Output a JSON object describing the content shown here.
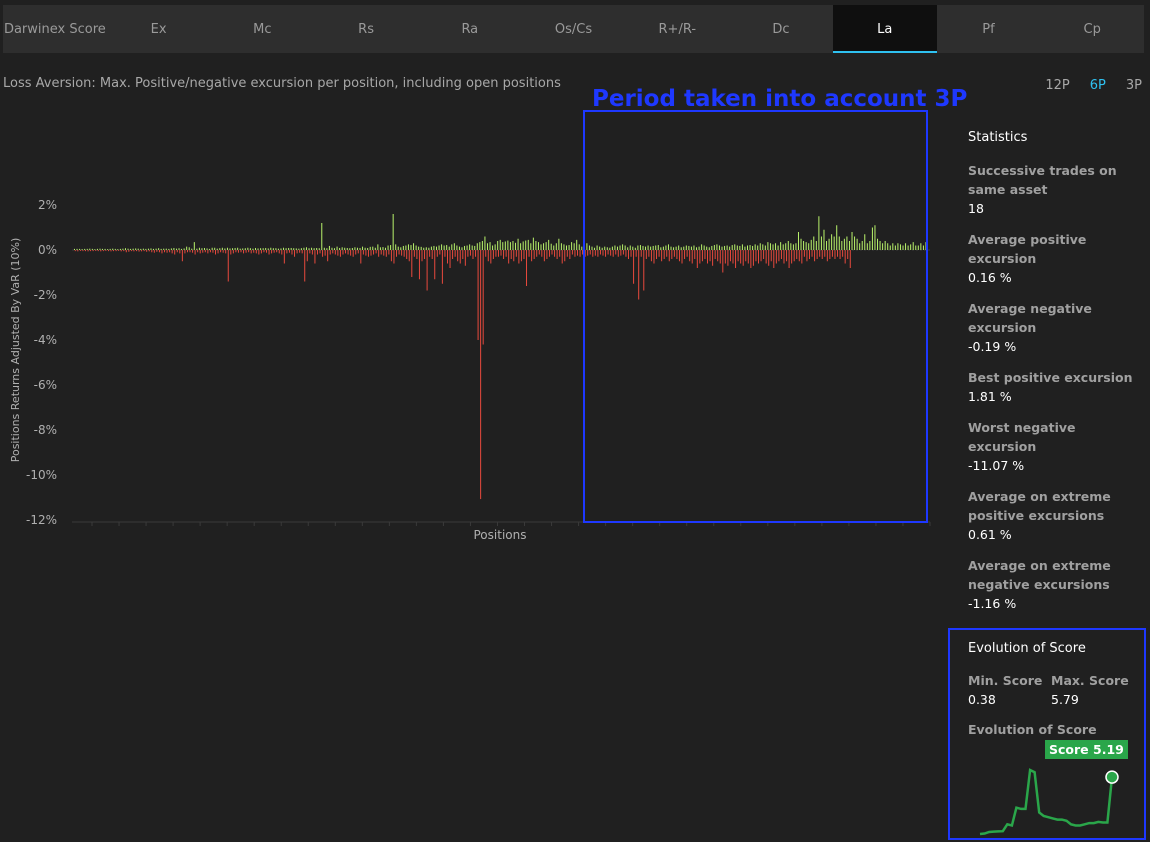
{
  "tabs": [
    {
      "label": "Darwinex Score"
    },
    {
      "label": "Ex"
    },
    {
      "label": "Mc"
    },
    {
      "label": "Rs"
    },
    {
      "label": "Ra"
    },
    {
      "label": "Os/Cs"
    },
    {
      "label": "R+/R-"
    },
    {
      "label": "Dc"
    },
    {
      "label": "La",
      "active": true
    },
    {
      "label": "Pf"
    },
    {
      "label": "Cp"
    }
  ],
  "subtitle": "Loss Aversion: Max. Positive/negative excursion per position, including open positions",
  "periods": [
    "12P",
    "6P",
    "3P"
  ],
  "active_period": "6P",
  "annotation": {
    "label": "Period taken into account 3P"
  },
  "statistics": {
    "title": "Statistics",
    "items": [
      {
        "label": "Successive trades on same asset",
        "value": "18"
      },
      {
        "label": "Average positive excursion",
        "value": "0.16 %"
      },
      {
        "label": "Average negative excursion",
        "value": "-0.19 %"
      },
      {
        "label": "Best positive excursion",
        "value": "1.81 %"
      },
      {
        "label": "Worst negative excursion",
        "value": "-11.07 %"
      },
      {
        "label": "Average on extreme positive excursions",
        "value": "0.61 %"
      },
      {
        "label": "Average on extreme negative excursions",
        "value": "-1.16 %"
      }
    ]
  },
  "evolution": {
    "title": "Evolution of Score",
    "min_label": "Min. Score",
    "min_value": "0.38",
    "max_label": "Max. Score",
    "max_value": "5.79",
    "subtitle": "Evolution of Score",
    "badge": "Score 5.19",
    "series": [
      0.38,
      0.42,
      0.55,
      0.58,
      0.6,
      0.62,
      1.2,
      1.1,
      2.6,
      2.5,
      2.5,
      5.79,
      5.6,
      2.2,
      1.9,
      1.8,
      1.7,
      1.6,
      1.6,
      1.5,
      1.2,
      1.1,
      1.1,
      1.2,
      1.3,
      1.3,
      1.4,
      1.35,
      1.35,
      5.19
    ],
    "line_color": "#2aa64a"
  },
  "colors": {
    "positive": "#b9f36b",
    "negative": "#e8493d",
    "accent": "#2fc1f0",
    "annotation": "#1e38ff"
  },
  "chart_data": {
    "type": "bar",
    "title": "",
    "xlabel": "Positions",
    "ylabel": "Positions Returns Adjusted By VaR (10%)",
    "yticks": [
      "2%",
      "0%",
      "-2%",
      "-4%",
      "-6%",
      "-8%",
      "-10%",
      "-12%"
    ],
    "ylim": [
      -12,
      2.5
    ],
    "positive_excursions": [
      0.05,
      0.05,
      0.05,
      0.04,
      0.05,
      0.05,
      0.06,
      0.05,
      0.04,
      0.05,
      0.06,
      0.05,
      0.05,
      0.04,
      0.05,
      0.06,
      0.05,
      0.04,
      0.05,
      0.06,
      0.08,
      0.06,
      0.05,
      0.06,
      0.07,
      0.06,
      0.05,
      0.06,
      0.05,
      0.06,
      0.07,
      0.05,
      0.06,
      0.08,
      0.05,
      0.06,
      0.06,
      0.05,
      0.07,
      0.09,
      0.06,
      0.08,
      0.05,
      0.07,
      0.15,
      0.12,
      0.06,
      0.35,
      0.06,
      0.1,
      0.08,
      0.09,
      0.07,
      0.05,
      0.1,
      0.1,
      0.06,
      0.08,
      0.1,
      0.07,
      0.1,
      0.07,
      0.08,
      0.09,
      0.1,
      0.06,
      0.07,
      0.08,
      0.1,
      0.08,
      0.06,
      0.09,
      0.07,
      0.08,
      0.08,
      0.09,
      0.07,
      0.1,
      0.08,
      0.08,
      0.06,
      0.07,
      0.1,
      0.08,
      0.09,
      0.09,
      0.08,
      0.07,
      0.06,
      0.08,
      0.1,
      0.12,
      0.08,
      0.1,
      0.08,
      0.09,
      0.08,
      1.2,
      0.1,
      0.08,
      0.18,
      0.1,
      0.08,
      0.15,
      0.09,
      0.12,
      0.1,
      0.09,
      0.08,
      0.09,
      0.12,
      0.1,
      0.09,
      0.15,
      0.1,
      0.09,
      0.14,
      0.15,
      0.1,
      0.25,
      0.12,
      0.13,
      0.1,
      0.2,
      0.22,
      1.6,
      0.25,
      0.15,
      0.12,
      0.18,
      0.2,
      0.25,
      0.22,
      0.3,
      0.2,
      0.15,
      0.14,
      0.1,
      0.12,
      0.1,
      0.15,
      0.18,
      0.15,
      0.2,
      0.25,
      0.2,
      0.22,
      0.15,
      0.25,
      0.3,
      0.2,
      0.15,
      0.12,
      0.18,
      0.2,
      0.25,
      0.2,
      0.18,
      0.3,
      0.35,
      0.4,
      0.6,
      0.3,
      0.35,
      0.2,
      0.25,
      0.4,
      0.45,
      0.35,
      0.38,
      0.42,
      0.35,
      0.4,
      0.32,
      0.5,
      0.3,
      0.38,
      0.42,
      0.45,
      0.3,
      0.55,
      0.4,
      0.35,
      0.25,
      0.3,
      0.35,
      0.45,
      0.28,
      0.2,
      0.3,
      0.5,
      0.3,
      0.25,
      0.2,
      0.22,
      0.35,
      0.3,
      0.45,
      0.25,
      0.15,
      0.5,
      0.3,
      0.2,
      0.15,
      0.1,
      0.2,
      0.15,
      0.1,
      0.15,
      0.12,
      0.1,
      0.15,
      0.2,
      0.15,
      0.2,
      0.25,
      0.2,
      0.12,
      0.2,
      0.15,
      0.1,
      0.2,
      0.22,
      0.18,
      0.15,
      0.2,
      0.15,
      0.18,
      0.2,
      0.22,
      0.12,
      0.15,
      0.2,
      0.25,
      0.15,
      0.12,
      0.15,
      0.2,
      0.12,
      0.15,
      0.2,
      0.18,
      0.15,
      0.2,
      0.12,
      0.15,
      0.25,
      0.2,
      0.15,
      0.12,
      0.18,
      0.22,
      0.25,
      0.2,
      0.15,
      0.18,
      0.2,
      0.15,
      0.22,
      0.25,
      0.2,
      0.18,
      0.25,
      0.15,
      0.2,
      0.22,
      0.18,
      0.25,
      0.2,
      0.3,
      0.25,
      0.2,
      0.35,
      0.3,
      0.25,
      0.3,
      0.2,
      0.35,
      0.25,
      0.3,
      0.4,
      0.3,
      0.25,
      0.3,
      0.8,
      0.5,
      0.4,
      0.35,
      0.3,
      0.45,
      0.6,
      0.4,
      1.5,
      0.6,
      0.9,
      0.4,
      0.5,
      0.7,
      0.6,
      1.1,
      0.6,
      0.4,
      0.5,
      0.6,
      0.4,
      0.8,
      0.6,
      0.5,
      0.3,
      0.4,
      0.7,
      0.3,
      0.4,
      1.0,
      1.1,
      0.5,
      0.4,
      0.3,
      0.4,
      0.3,
      0.2,
      0.3,
      0.2,
      0.3,
      0.25,
      0.2,
      0.3,
      0.2,
      0.25,
      0.35,
      0.2,
      0.2,
      0.3,
      0.2,
      0.35
    ],
    "negative_excursions": [
      -0.05,
      -0.06,
      -0.04,
      -0.05,
      -0.05,
      -0.06,
      -0.05,
      -0.05,
      -0.04,
      -0.05,
      -0.06,
      -0.05,
      -0.04,
      -0.05,
      -0.06,
      -0.05,
      -0.05,
      -0.04,
      -0.06,
      -0.05,
      -0.1,
      -0.08,
      -0.05,
      -0.06,
      -0.05,
      -0.07,
      -0.06,
      -0.05,
      -0.08,
      -0.06,
      -0.1,
      -0.12,
      -0.08,
      -0.1,
      -0.15,
      -0.1,
      -0.12,
      -0.1,
      -0.15,
      -0.2,
      -0.1,
      -0.15,
      -0.5,
      -0.15,
      -0.1,
      -0.1,
      -0.12,
      -0.2,
      -0.1,
      -0.15,
      -0.12,
      -0.1,
      -0.15,
      -0.1,
      -0.12,
      -0.2,
      -0.15,
      -0.1,
      -0.12,
      -0.15,
      -1.4,
      -0.2,
      -0.15,
      -0.1,
      -0.12,
      -0.1,
      -0.15,
      -0.12,
      -0.1,
      -0.15,
      -0.12,
      -0.15,
      -0.2,
      -0.15,
      -0.1,
      -0.12,
      -0.2,
      -0.15,
      -0.12,
      -0.1,
      -0.15,
      -0.2,
      -0.6,
      -0.15,
      -0.12,
      -0.2,
      -0.3,
      -0.15,
      -0.12,
      -0.15,
      -1.4,
      -0.5,
      -0.15,
      -0.2,
      -0.6,
      -0.2,
      -0.15,
      -0.3,
      -0.25,
      -0.5,
      -0.2,
      -0.15,
      -0.2,
      -0.25,
      -0.3,
      -0.2,
      -0.15,
      -0.2,
      -0.25,
      -0.3,
      -0.2,
      -0.15,
      -0.6,
      -0.2,
      -0.25,
      -0.3,
      -0.25,
      -0.2,
      -0.15,
      -0.3,
      -0.2,
      -0.25,
      -0.3,
      -0.2,
      -0.5,
      -0.6,
      -0.3,
      -0.2,
      -0.25,
      -0.3,
      -0.4,
      -0.5,
      -1.2,
      -0.3,
      -0.4,
      -1.3,
      -0.5,
      -0.4,
      -1.8,
      -0.3,
      -0.4,
      -1.3,
      -0.3,
      -0.2,
      -1.5,
      -0.3,
      -0.6,
      -0.8,
      -0.4,
      -0.3,
      -0.5,
      -0.6,
      -0.4,
      -0.7,
      -0.3,
      -0.25,
      -0.4,
      -0.3,
      -4.0,
      -11.07,
      -4.2,
      -0.3,
      -0.5,
      -0.6,
      -0.4,
      -0.3,
      -0.3,
      -0.25,
      -0.4,
      -0.3,
      -0.6,
      -0.4,
      -0.5,
      -0.3,
      -0.6,
      -0.5,
      -0.4,
      -1.6,
      -0.3,
      -0.5,
      -0.4,
      -0.3,
      -0.2,
      -0.3,
      -0.5,
      -0.4,
      -0.3,
      -0.2,
      -0.3,
      -0.4,
      -0.3,
      -0.6,
      -0.5,
      -0.3,
      -0.4,
      -0.2,
      -0.3,
      -0.25,
      -0.3,
      -0.2,
      -0.3,
      -0.25,
      -0.2,
      -0.3,
      -0.25,
      -0.3,
      -0.2,
      -0.25,
      -0.3,
      -0.2,
      -0.25,
      -0.3,
      -0.2,
      -0.3,
      -0.25,
      -0.2,
      -0.3,
      -0.4,
      -0.3,
      -1.5,
      -0.3,
      -2.2,
      -0.3,
      -1.8,
      -0.4,
      -0.3,
      -0.5,
      -0.6,
      -0.4,
      -0.3,
      -0.5,
      -0.4,
      -0.3,
      -0.5,
      -0.4,
      -0.3,
      -0.4,
      -0.5,
      -0.6,
      -0.4,
      -0.3,
      -0.5,
      -0.6,
      -0.4,
      -0.8,
      -0.6,
      -0.5,
      -0.4,
      -0.6,
      -0.5,
      -0.7,
      -0.4,
      -0.5,
      -0.6,
      -1.0,
      -0.6,
      -0.7,
      -0.5,
      -0.6,
      -0.8,
      -0.5,
      -0.6,
      -0.7,
      -0.5,
      -0.6,
      -0.8,
      -0.7,
      -0.5,
      -0.6,
      -0.5,
      -0.4,
      -0.6,
      -0.7,
      -0.5,
      -0.8,
      -0.6,
      -0.5,
      -0.4,
      -0.6,
      -0.5,
      -0.8,
      -0.6,
      -0.5,
      -0.4,
      -0.5,
      -0.6,
      -0.3,
      -0.5,
      -0.4,
      -0.3,
      -0.5,
      -0.4,
      -0.3,
      -0.4,
      -0.3,
      -0.5,
      -0.4,
      -0.3,
      -0.4,
      -0.3,
      -0.4,
      -0.3,
      -0.6,
      -0.4,
      -0.8
    ]
  }
}
